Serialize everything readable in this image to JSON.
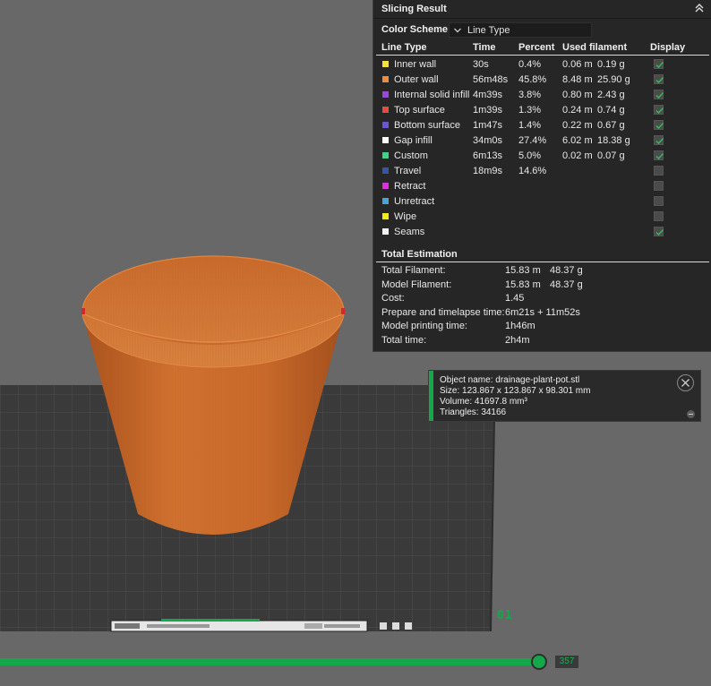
{
  "panel": {
    "title": "Slicing Result",
    "color_scheme_label": "Color Scheme",
    "color_scheme_value": "Line Type",
    "columns": [
      "Line Type",
      "Time",
      "Percent",
      "Used filament",
      "Display"
    ],
    "rows": [
      {
        "name": "Inner wall",
        "color": "#f4e13a",
        "time": "30s",
        "percent": "0.4%",
        "length": "0.06 m",
        "weight": "0.19 g",
        "display": true
      },
      {
        "name": "Outer wall",
        "color": "#ef8b3a",
        "time": "56m48s",
        "percent": "45.8%",
        "length": "8.48 m",
        "weight": "25.90 g",
        "display": true
      },
      {
        "name": "Internal solid infill",
        "color": "#9a47d6",
        "time": "4m39s",
        "percent": "3.8%",
        "length": "0.80 m",
        "weight": "2.43 g",
        "display": true
      },
      {
        "name": "Top surface",
        "color": "#e84a3f",
        "time": "1m39s",
        "percent": "1.3%",
        "length": "0.24 m",
        "weight": "0.74 g",
        "display": true
      },
      {
        "name": "Bottom surface",
        "color": "#6b55d4",
        "time": "1m47s",
        "percent": "1.4%",
        "length": "0.22 m",
        "weight": "0.67 g",
        "display": true
      },
      {
        "name": "Gap infill",
        "color": "#ffffff",
        "time": "34m0s",
        "percent": "27.4%",
        "length": "6.02 m",
        "weight": "18.38 g",
        "display": true
      },
      {
        "name": "Custom",
        "color": "#3fd38a",
        "time": "6m13s",
        "percent": "5.0%",
        "length": "0.02 m",
        "weight": "0.07 g",
        "display": true
      },
      {
        "name": "Travel",
        "color": "#3f4fb0",
        "time": "18m9s",
        "percent": "14.6%",
        "length": "",
        "weight": "",
        "display": false
      },
      {
        "name": "Retract",
        "color": "#d832d8",
        "time": "",
        "percent": "",
        "length": "",
        "weight": "",
        "display": false
      },
      {
        "name": "Unretract",
        "color": "#47a3d8",
        "time": "",
        "percent": "",
        "length": "",
        "weight": "",
        "display": false
      },
      {
        "name": "Wipe",
        "color": "#f4ea1a",
        "time": "",
        "percent": "",
        "length": "",
        "weight": "",
        "display": false
      },
      {
        "name": "Seams",
        "color": "#f2f2f2",
        "time": "",
        "percent": "",
        "length": "",
        "weight": "",
        "display": true
      }
    ],
    "total_title": "Total Estimation",
    "totals": [
      {
        "label": "Total Filament:",
        "v1": "15.83 m",
        "v2": "48.37 g"
      },
      {
        "label": "Model Filament:",
        "v1": "15.83 m",
        "v2": "48.37 g"
      },
      {
        "label": "Cost:",
        "v1": "1.45",
        "v2": ""
      },
      {
        "label": "Prepare and timelapse time:",
        "v1": "6m21s + 11m52s",
        "v2": ""
      },
      {
        "label": "Model printing time:",
        "v1": "1h46m",
        "v2": ""
      },
      {
        "label": "Total time:",
        "v1": "2h4m",
        "v2": ""
      }
    ]
  },
  "object_info": {
    "name": "Object name: drainage-plant-pot.stl",
    "size": "Size: 123.867 x 123.867 x 98.301 mm",
    "volume": "Volume: 41697.8 mm³",
    "triangles": "Triangles: 34166"
  },
  "layer_slider": {
    "value": "357"
  },
  "plate_number": "01",
  "colors": {
    "accent": "#14a84b",
    "model": "#c9692c",
    "panel_bg": "#262626",
    "scene_bg": "#686868"
  }
}
